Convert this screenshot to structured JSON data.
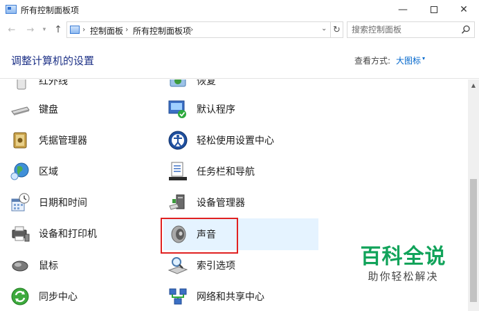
{
  "window": {
    "title": "所有控制面板项",
    "min_glyph": "—",
    "close_glyph": "✕"
  },
  "nav": {
    "back_glyph": "←",
    "forward_glyph": "→",
    "history_glyph": "▾",
    "up_glyph": "↑",
    "breadcrumbs": [
      "控制面板",
      "所有控制面板项"
    ],
    "crumb_sep": "›",
    "dropdown_glyph": "⌄",
    "refresh_glyph": "↻"
  },
  "search": {
    "placeholder": "搜索控制面板"
  },
  "header": {
    "title": "调整计算机的设置",
    "view_label": "查看方式:",
    "view_value": "大图标",
    "view_caret": "▾"
  },
  "items": [
    {
      "label": "红外线",
      "icon": "infrared-icon"
    },
    {
      "label": "恢复",
      "icon": "recovery-icon"
    },
    {
      "label": "键盘",
      "icon": "keyboard-icon"
    },
    {
      "label": "默认程序",
      "icon": "default-programs-icon"
    },
    {
      "label": "凭据管理器",
      "icon": "credential-manager-icon"
    },
    {
      "label": "轻松使用设置中心",
      "icon": "ease-of-access-icon"
    },
    {
      "label": "区域",
      "icon": "region-icon"
    },
    {
      "label": "任务栏和导航",
      "icon": "taskbar-icon"
    },
    {
      "label": "日期和时间",
      "icon": "date-time-icon"
    },
    {
      "label": "设备管理器",
      "icon": "device-manager-icon"
    },
    {
      "label": "设备和打印机",
      "icon": "devices-printers-icon"
    },
    {
      "label": "声音",
      "icon": "sound-icon"
    },
    {
      "label": "鼠标",
      "icon": "mouse-icon"
    },
    {
      "label": "索引选项",
      "icon": "indexing-icon"
    },
    {
      "label": "同步中心",
      "icon": "sync-center-icon"
    },
    {
      "label": "网络和共享中心",
      "icon": "network-sharing-icon"
    }
  ],
  "watermark": {
    "main": "百科全说",
    "sub": "助你轻松解决"
  },
  "scrollbar": {
    "up_glyph": "▲"
  },
  "colors": {
    "accent": "#0066cc",
    "title_blue": "#1e3287",
    "highlight": "#e02020",
    "hover_bg": "#e5f3ff",
    "watermark_green": "#11a35a"
  }
}
